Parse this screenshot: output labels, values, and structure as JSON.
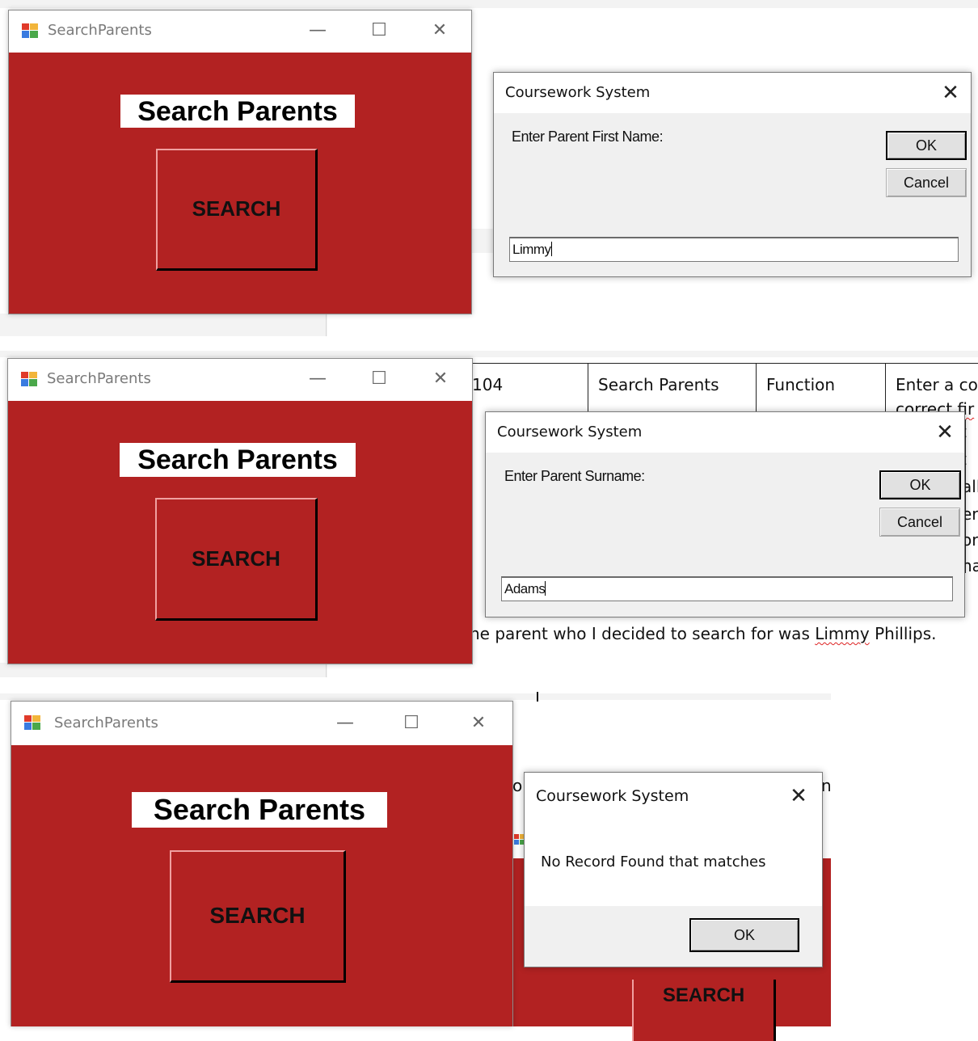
{
  "panel1": {
    "window": {
      "title": "SearchParents",
      "heading": "Search Parents",
      "search_button": "SEARCH"
    },
    "dialog": {
      "title": "Coursework System",
      "prompt": "Enter Parent First Name:",
      "ok": "OK",
      "cancel": "Cancel",
      "input_value": "Limmy"
    }
  },
  "panel2": {
    "window": {
      "title": "SearchParents",
      "heading": "Search Parents",
      "search_button": "SEARCH"
    },
    "dialog": {
      "title": "Coursework System",
      "prompt": "Enter Parent Surname:",
      "ok": "OK",
      "cancel": "Cancel",
      "input_value": "Adams"
    },
    "background_doc": {
      "table_cells": [
        "104",
        "Search Parents",
        "Function",
        "Enter a co"
      ],
      "table_second_line": "correct fir",
      "right_fragments": [
        "t",
        "t",
        "all",
        "er",
        "or",
        "na"
      ],
      "sentence_prefix": "he parent who I decided to search for was ",
      "sentence_name": "Limmy",
      "sentence_suffix": " Phillips."
    }
  },
  "panel3": {
    "window": {
      "title": "SearchParents",
      "heading": "Search Parents",
      "search_button": "SEARCH"
    },
    "dialog": {
      "title": "Coursework System",
      "message": "No Record Found that matches",
      "ok": "OK"
    },
    "behind_window": {
      "search_button": "SEARCH"
    }
  },
  "colors": {
    "form_background": "#b22222",
    "dialog_background": "#f0f0f0"
  },
  "icons": [
    "app-icon",
    "minimize-icon",
    "maximize-icon",
    "close-icon"
  ]
}
